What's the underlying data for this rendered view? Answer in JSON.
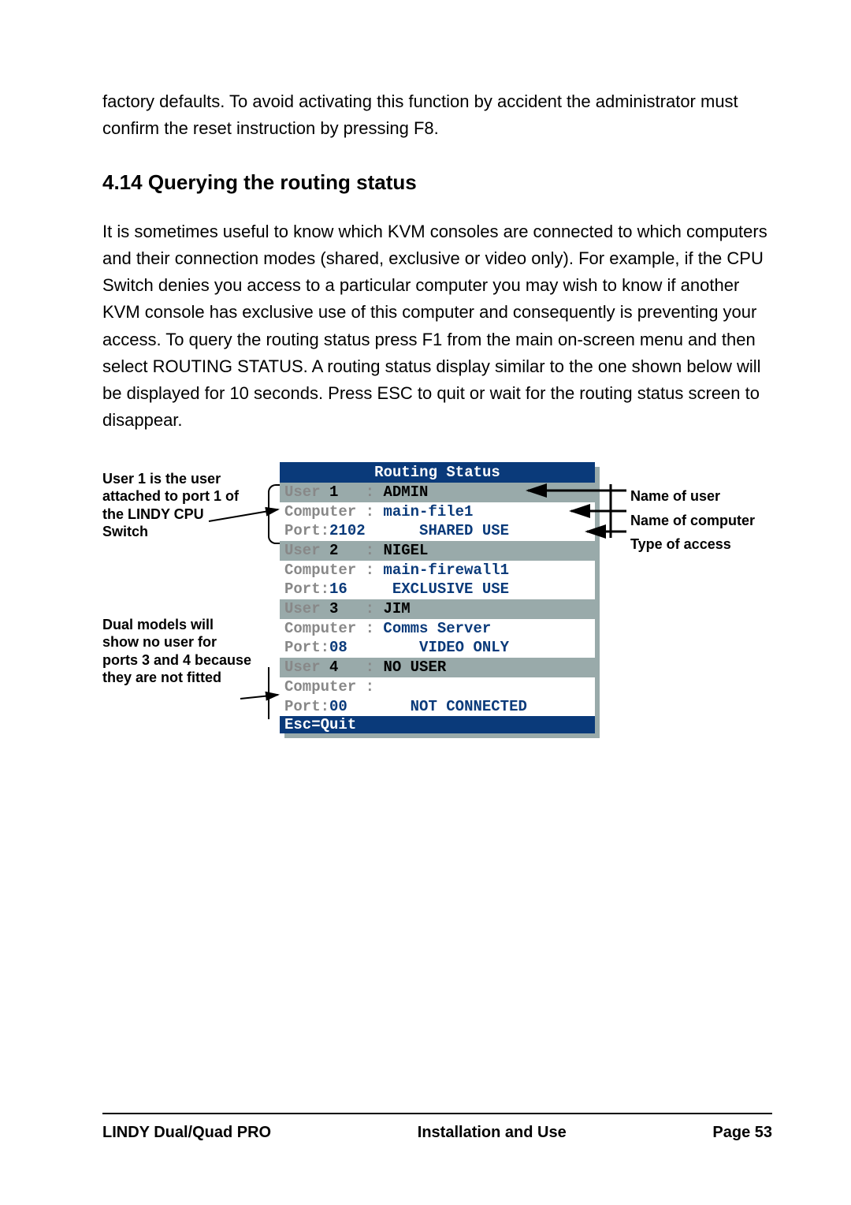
{
  "intro_para": "factory defaults. To avoid activating this function by accident the administrator must confirm the reset instruction by pressing F8.",
  "section_heading": "4.14 Querying the routing status",
  "body_para": "It is sometimes useful to know which KVM consoles are connected to which computers and their connection modes (shared, exclusive or video only). For example, if the CPU Switch denies you access to a particular computer you may wish to know if another KVM console has exclusive use of this computer and consequently is preventing your access.  To query the routing status press F1 from the main on-screen menu and then select ROUTING STATUS. A routing status display similar to the one shown below will be displayed for 10 seconds. Press ESC to quit or wait for the routing status screen to disappear.",
  "annot_left1": "User 1 is the user attached to port 1 of the LINDY CPU Switch",
  "annot_left2": "Dual models will show no user for ports 3 and 4 because they are not fitted",
  "osd_title": "Routing Status",
  "routing": [
    {
      "user_no": "1",
      "user_name": "ADMIN",
      "computer": "main-file1",
      "port": "2102",
      "access": "SHARED USE"
    },
    {
      "user_no": "2",
      "user_name": "NIGEL",
      "computer": "main-firewall1",
      "port": "16",
      "access": "EXCLUSIVE USE"
    },
    {
      "user_no": "3",
      "user_name": "JIM",
      "computer": "Comms Server",
      "port": "08",
      "access": "VIDEO ONLY"
    },
    {
      "user_no": "4",
      "user_name": "NO USER",
      "computer": "",
      "port": "00",
      "access": "NOT CONNECTED"
    }
  ],
  "osd_footer": "Esc=Quit",
  "right_labels": {
    "a": "Name of user",
    "b": "Name of computer",
    "c": "Type of access"
  },
  "footer": {
    "left": "LINDY Dual/Quad PRO",
    "center": "Installation and Use",
    "right": "Page 53"
  },
  "chart_data": {
    "type": "table",
    "title": "Routing Status",
    "columns": [
      "User",
      "User Name",
      "Computer",
      "Port",
      "Access"
    ],
    "rows": [
      [
        "1",
        "ADMIN",
        "main-file1",
        "2102",
        "SHARED USE"
      ],
      [
        "2",
        "NIGEL",
        "main-firewall1",
        "16",
        "EXCLUSIVE USE"
      ],
      [
        "3",
        "JIM",
        "Comms Server",
        "08",
        "VIDEO ONLY"
      ],
      [
        "4",
        "NO USER",
        "",
        "00",
        "NOT CONNECTED"
      ]
    ]
  }
}
